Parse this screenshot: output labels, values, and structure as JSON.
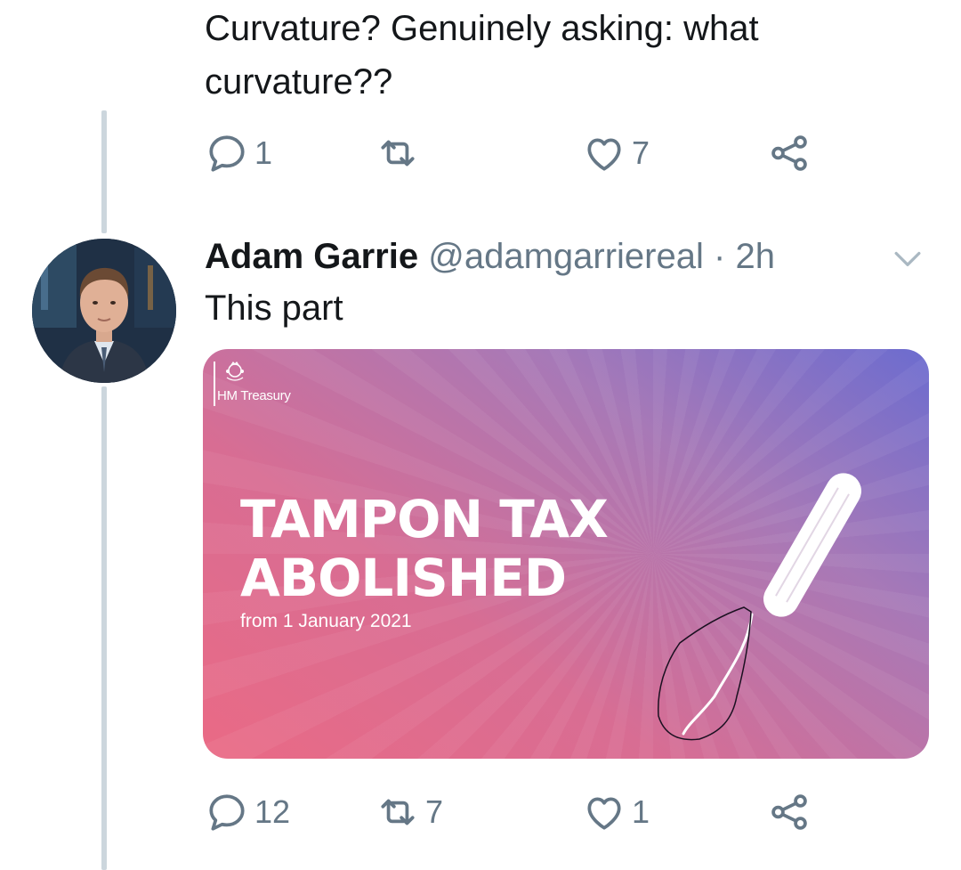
{
  "previous_tweet": {
    "text": "Curvature? Genuinely asking: what curvature??",
    "actions": {
      "reply_count": "1",
      "retweet_count": "",
      "like_count": "7"
    }
  },
  "tweet": {
    "author_name": "Adam Garrie",
    "author_handle": "@adamgarriereal",
    "separator": "·",
    "timestamp": "2h",
    "text": "This part",
    "card": {
      "org_name": "HM Treasury",
      "headline_line1": "TAMPON TAX",
      "headline_line2": "ABOLISHED",
      "subhead": "from 1 January 2021"
    },
    "actions": {
      "reply_count": "12",
      "retweet_count": "7",
      "like_count": "1"
    }
  },
  "icons": {
    "reply": "reply-icon",
    "retweet": "retweet-icon",
    "like": "heart-icon",
    "share": "share-icon",
    "menu": "chevron-down-icon"
  },
  "colors": {
    "text": "#14171a",
    "muted": "#657786",
    "thread_line": "#ccd6dd"
  }
}
